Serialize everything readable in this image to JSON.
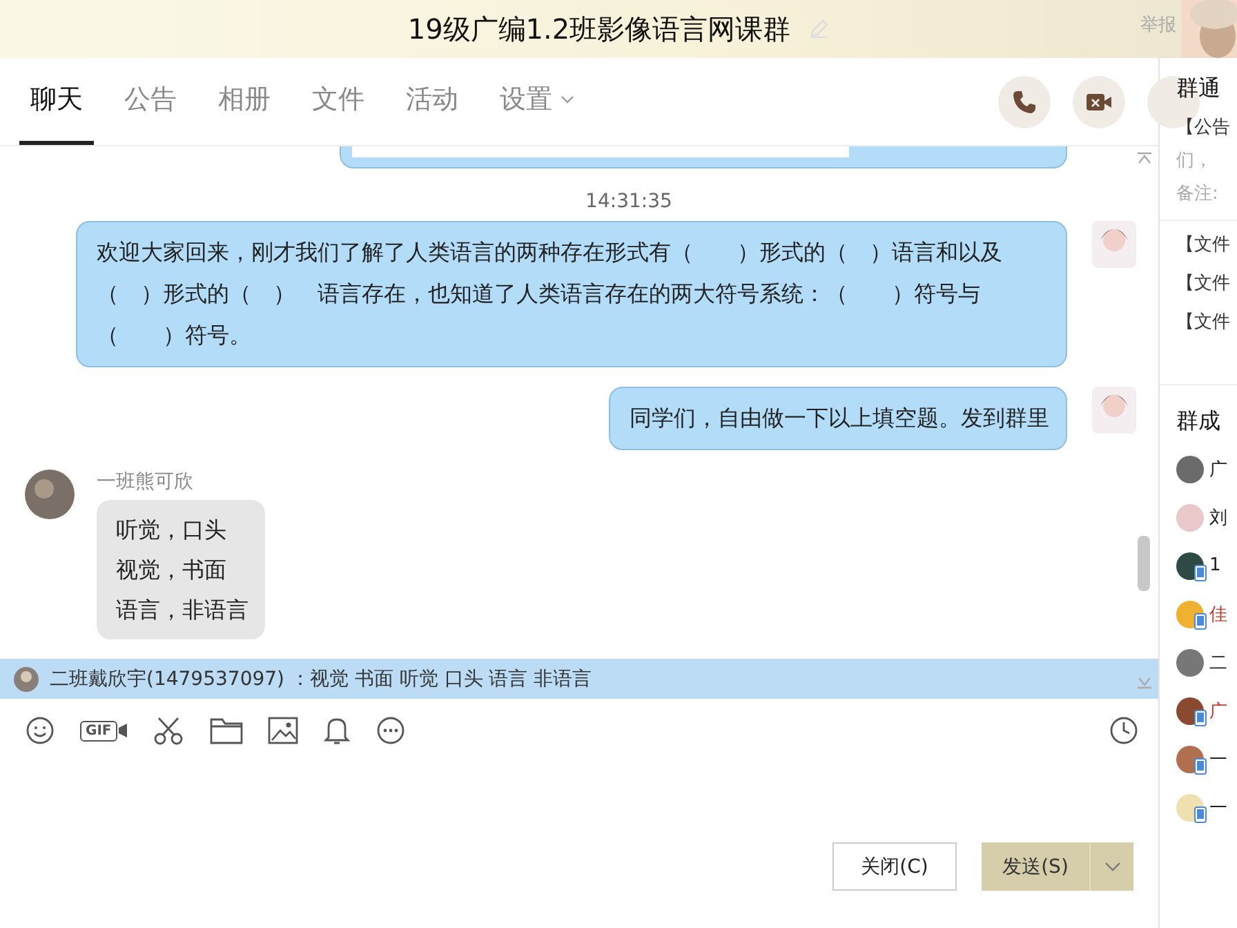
{
  "window": {
    "title": "19级广编1.2班影像语言网课群",
    "report": "举报"
  },
  "tabs": [
    {
      "label": "聊天",
      "selected": true,
      "has_menu": false
    },
    {
      "label": "公告",
      "selected": false,
      "has_menu": false
    },
    {
      "label": "相册",
      "selected": false,
      "has_menu": false
    },
    {
      "label": "文件",
      "selected": false,
      "has_menu": false
    },
    {
      "label": "活动",
      "selected": false,
      "has_menu": false
    },
    {
      "label": "设置",
      "selected": false,
      "has_menu": true
    }
  ],
  "messages": [
    {
      "kind": "time",
      "text": "14:31:35"
    },
    {
      "kind": "self",
      "text": "欢迎大家回来，刚才我们了解了人类语言的两种存在形式有（　　）形式的（　）语言和以及（　）形式的（　）　语言存在，也知道了人类语言存在的两大符号系统：（　　）符号与（　　）符号。"
    },
    {
      "kind": "self",
      "text": "同学们，自由做一下以上填空题。发到群里"
    },
    {
      "kind": "other",
      "sender": "一班熊可欣",
      "lines": [
        "听觉，口头",
        "视觉，书面",
        "语言，非语言"
      ]
    }
  ],
  "notice": {
    "text": "二班戴欣宇(1479537097) ：视觉 书面 听觉 口头 语言 非语言"
  },
  "toolbar": {
    "gif_label": "GIF"
  },
  "buttons": {
    "close": "关闭(C)",
    "send": "发送(S)"
  },
  "sidebar": {
    "notice_title": "群通",
    "notice_lines": [
      "【公告",
      "们，",
      "备注:"
    ],
    "files": [
      "【文件",
      "【文件",
      "【文件"
    ],
    "members_title": "群成",
    "members": [
      {
        "name": "广",
        "highlighted": false,
        "mobile": false
      },
      {
        "name": "刘",
        "highlighted": false,
        "mobile": false
      },
      {
        "name": "1",
        "highlighted": false,
        "mobile": true
      },
      {
        "name": "佳",
        "highlighted": true,
        "mobile": true
      },
      {
        "name": "二",
        "highlighted": false,
        "mobile": false
      },
      {
        "name": "广",
        "highlighted": true,
        "mobile": true
      },
      {
        "name": "一",
        "highlighted": false,
        "mobile": true
      },
      {
        "name": "一",
        "highlighted": false,
        "mobile": true
      }
    ]
  }
}
